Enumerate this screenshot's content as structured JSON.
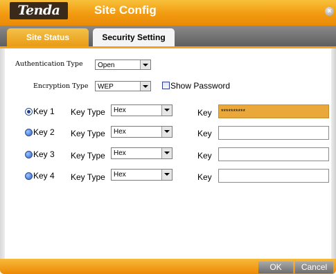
{
  "window": {
    "logo": "Tenda",
    "title": "Site Config",
    "close": "×"
  },
  "tabs": [
    {
      "label": "Site Status",
      "active": true
    },
    {
      "label": "Security Setting",
      "active": false
    }
  ],
  "form": {
    "auth_label": "Authentication Type",
    "auth_value": "Open",
    "enc_label": "Encryption Type",
    "enc_value": "WEP",
    "show_password": "Show Password"
  },
  "keys": [
    {
      "label": "Key 1",
      "type_label": "Key Type",
      "type_value": "Hex",
      "key_label": "Key",
      "value": "**********",
      "selected": true
    },
    {
      "label": "Key 2",
      "type_label": "Key Type",
      "type_value": "Hex",
      "key_label": "Key",
      "value": "",
      "selected": false
    },
    {
      "label": "Key 3",
      "type_label": "Key Type",
      "type_value": "Hex",
      "key_label": "Key",
      "value": "",
      "selected": false
    },
    {
      "label": "Key 4",
      "type_label": "Key Type",
      "type_value": "Hex",
      "key_label": "Key",
      "value": "",
      "selected": false
    }
  ],
  "footer": {
    "ok": "OK",
    "cancel": "Cancel"
  },
  "colors": {
    "accent": "#f29a10",
    "key_active_bg": "#eba83a"
  }
}
